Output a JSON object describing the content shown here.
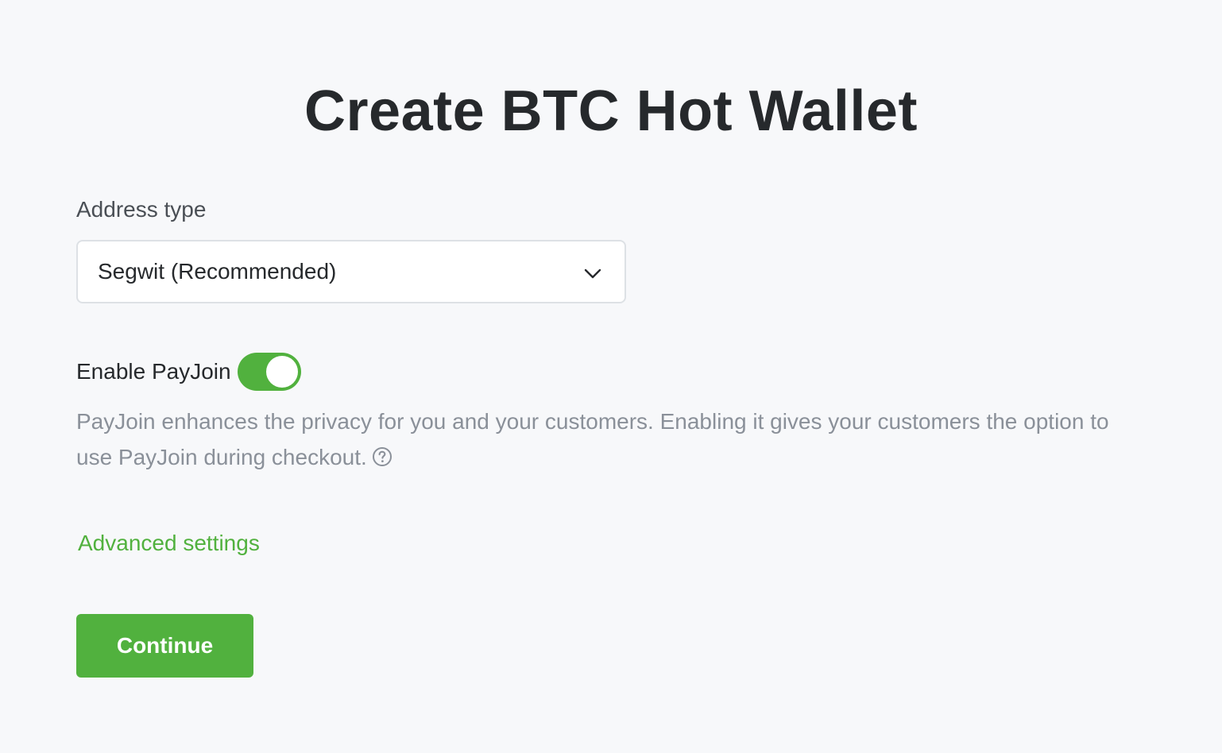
{
  "page": {
    "title": "Create BTC Hot Wallet"
  },
  "address_type": {
    "label": "Address type",
    "selected": "Segwit (Recommended)",
    "icon": "chevron-down-icon"
  },
  "payjoin": {
    "label": "Enable PayJoin",
    "enabled": true,
    "description": "PayJoin enhances the privacy for you and your customers. Enabling it gives your customers the option to use PayJoin during checkout.",
    "help_icon": "question-circle-icon"
  },
  "advanced": {
    "label": "Advanced settings"
  },
  "actions": {
    "continue_label": "Continue"
  },
  "colors": {
    "accent": "#51b13e",
    "background": "#f7f8fa",
    "muted_text": "#8a9099"
  }
}
